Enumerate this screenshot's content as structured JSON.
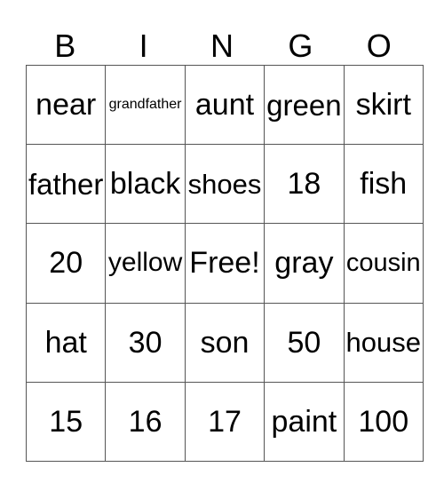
{
  "header": [
    "B",
    "I",
    "N",
    "G",
    "O"
  ],
  "rows": [
    [
      "near",
      "grandfather",
      "aunt",
      "green",
      "skirt"
    ],
    [
      "father",
      "black",
      "shoes",
      "18",
      "fish"
    ],
    [
      "20",
      "yellow",
      "Free!",
      "gray",
      "cousin"
    ],
    [
      "hat",
      "30",
      "son",
      "50",
      "house"
    ],
    [
      "15",
      "16",
      "17",
      "paint",
      "100"
    ]
  ]
}
